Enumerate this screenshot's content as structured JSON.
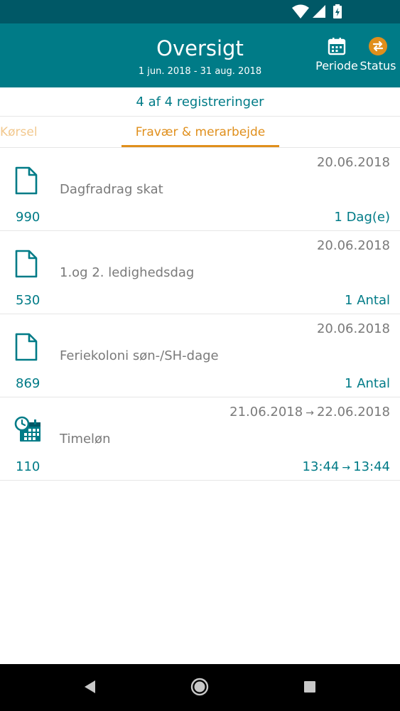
{
  "app": {
    "title": "Oversigt",
    "subtitle": "1 jun. 2018 - 31 aug. 2018",
    "actions": {
      "periode": "Periode",
      "status": "Status"
    }
  },
  "summary": "4 af 4 registreringer",
  "tabs": {
    "korsel": "Kørsel",
    "fravaer": "Fravær & merarbejde",
    "active": "fravaer"
  },
  "records": [
    {
      "icon": "document-icon",
      "date": "20.06.2018",
      "name": "Dagfradrag skat",
      "code": "990",
      "amount": "1 Dag(e)"
    },
    {
      "icon": "document-icon",
      "date": "20.06.2018",
      "name": "1.og 2. ledighedsdag",
      "code": "530",
      "amount": "1 Antal"
    },
    {
      "icon": "document-icon",
      "date": "20.06.2018",
      "name": "Feriekoloni søn-/SH-dage",
      "code": "869",
      "amount": "1 Antal"
    },
    {
      "icon": "clock-calendar-icon",
      "date_from": "21.06.2018",
      "date_to": "22.06.2018",
      "name": "Timeløn",
      "code": "110",
      "time_from": "13:44",
      "time_to": "13:44"
    }
  ],
  "colors": {
    "primary": "#007b87",
    "status_bar": "#005866",
    "accent": "#e08f1c",
    "muted": "#7a7a7a"
  }
}
